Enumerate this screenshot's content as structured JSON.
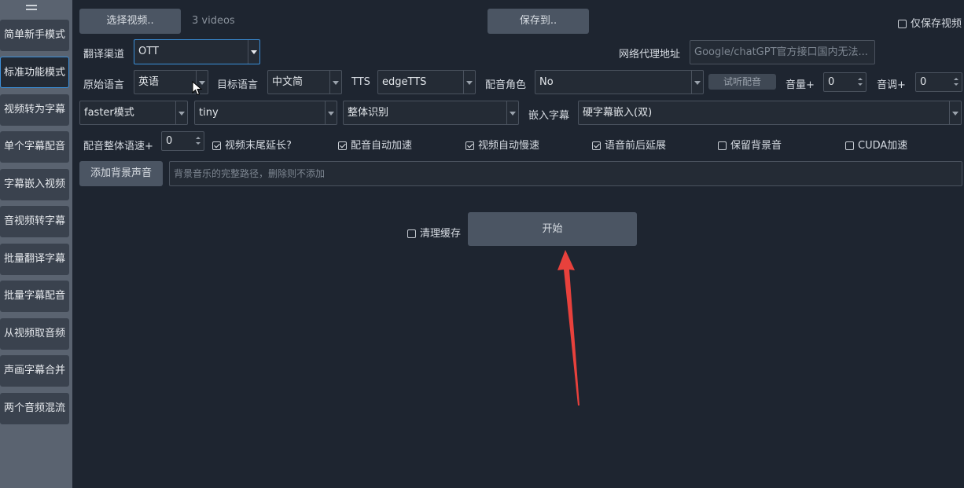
{
  "sidebar": {
    "items": [
      {
        "label": "简单新手模式",
        "active": false
      },
      {
        "label": "标准功能模式",
        "active": true
      },
      {
        "label": "视频转为字幕",
        "active": false
      },
      {
        "label": "单个字幕配音",
        "active": false
      },
      {
        "label": "字幕嵌入视频",
        "active": false
      },
      {
        "label": "音视频转字幕",
        "active": false
      },
      {
        "label": "批量翻译字幕",
        "active": false
      },
      {
        "label": "批量字幕配音",
        "active": false
      },
      {
        "label": "从视频取音频",
        "active": false
      },
      {
        "label": "声画字幕合并",
        "active": false
      },
      {
        "label": "两个音频混流",
        "active": false
      }
    ]
  },
  "top": {
    "select_video": "选择视频..",
    "video_count": "3 videos",
    "save_to": "保存到..",
    "only_save_video": "仅保存视频"
  },
  "row1": {
    "channel_label": "翻译渠道",
    "channel_value": "OTT",
    "proxy_label": "网络代理地址",
    "proxy_placeholder": "Google/chatGPT官方接口国内无法..."
  },
  "row2": {
    "source_label": "原始语言",
    "source_value": "英语",
    "target_label": "目标语言",
    "target_value": "中文简",
    "tts_label": "TTS",
    "tts_value": "edgeTTS",
    "role_label": "配音角色",
    "role_value": "No",
    "listen_button": "试听配音",
    "volume_label": "音量+",
    "volume_value": "0",
    "pitch_label": "音调+",
    "pitch_value": "0"
  },
  "row3": {
    "mode_value": "faster模式",
    "model_value": "tiny",
    "recog_value": "整体识别",
    "embed_label": "嵌入字幕",
    "embed_value": "硬字幕嵌入(双)"
  },
  "row4": {
    "speed_label": "配音整体语速+",
    "speed_value": "0",
    "options": [
      {
        "label": "视频末尾延长?",
        "checked": true
      },
      {
        "label": "配音自动加速",
        "checked": true
      },
      {
        "label": "视频自动慢速",
        "checked": true
      },
      {
        "label": "语音前后延展",
        "checked": true
      },
      {
        "label": "保留背景音",
        "checked": false
      },
      {
        "label": "CUDA加速",
        "checked": false
      }
    ]
  },
  "row5": {
    "add_bg_button": "添加背景声音",
    "bg_placeholder": "背景音乐的完整路径，删除则不添加"
  },
  "action": {
    "clear_cache": "清理缓存",
    "clear_cache_checked": false,
    "start": "开始"
  },
  "colors": {
    "background": "#1e2530",
    "sidebar": "#5a6370",
    "accent": "#3b8fd9",
    "annotation_arrow": "#e8413c"
  }
}
